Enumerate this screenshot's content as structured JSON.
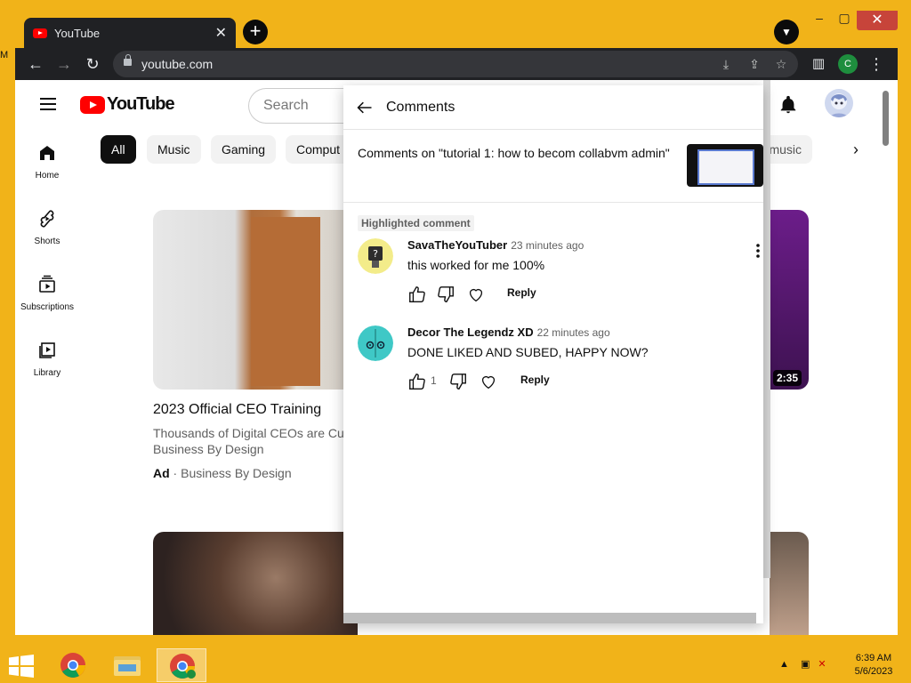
{
  "desktop": {
    "edge_text": "M"
  },
  "browser": {
    "tab_title": "YouTube",
    "url": "youtube.com",
    "profile_initial": "C"
  },
  "youtube": {
    "logo_text": "YouTube",
    "search_placeholder": "Search",
    "guide": [
      {
        "label": "Home",
        "icon": "home-icon"
      },
      {
        "label": "Shorts",
        "icon": "shorts-icon"
      },
      {
        "label": "Subscriptions",
        "icon": "subscriptions-icon"
      },
      {
        "label": "Library",
        "icon": "library-icon"
      }
    ],
    "chips": [
      "All",
      "Music",
      "Gaming",
      "Comput",
      "nd music"
    ],
    "video": {
      "title": "2023 Official CEO Training",
      "desc_line1": "Thousands of Digital CEOs are Cur",
      "desc_line2": "Business By Design",
      "ad_label": "Ad",
      "channel": "Business By Design"
    },
    "side_duration": "2:35"
  },
  "comments_panel": {
    "title": "Comments",
    "context": "Comments on \"tutorial 1: how to becom collabvm admin\"",
    "highlight_badge": "Highlighted comment",
    "comments": [
      {
        "author": "SavaTheYouTuber",
        "time": "23 minutes ago",
        "text": "this worked for me 100%",
        "likes": "",
        "reply_label": "Reply"
      },
      {
        "author": "Decor The Legendz XD",
        "time": "22 minutes ago",
        "text": "DONE LIKED AND SUBED, HAPPY NOW?",
        "likes": "1",
        "reply_label": "Reply"
      }
    ]
  },
  "taskbar": {
    "time": "6:39 AM",
    "date": "5/6/2023"
  },
  "colors": {
    "desktop": "#f1b319",
    "youtube_red": "#ff0000",
    "chrome_dark": "#202124"
  }
}
